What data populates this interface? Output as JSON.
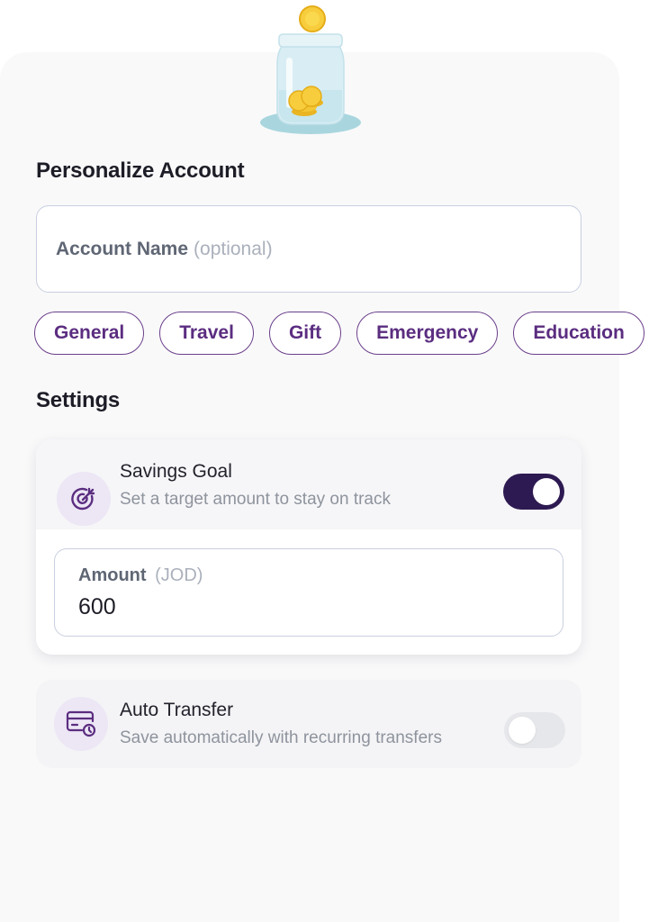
{
  "personalize": {
    "title": "Personalize Account",
    "account_name_label": "Account Name",
    "account_name_optional": "(optional)",
    "account_name_value": ""
  },
  "categories": [
    "General",
    "Travel",
    "Gift",
    "Emergency",
    "Education"
  ],
  "settings": {
    "title": "Settings",
    "savings_goal": {
      "title": "Savings Goal",
      "subtitle": "Set a target amount to stay on track",
      "enabled": true,
      "icon": "target-icon",
      "amount_label": "Amount",
      "amount_unit": "(JOD)",
      "amount_value": "600"
    },
    "auto_transfer": {
      "title": "Auto Transfer",
      "subtitle": "Save automatically with recurring transfers",
      "enabled": false,
      "icon": "scheduled-card-icon"
    }
  },
  "colors": {
    "accent": "#2e1a52",
    "chip_border": "#6b3f8a",
    "chip_text": "#5b2d80",
    "icon_bg": "#ece6f5"
  }
}
